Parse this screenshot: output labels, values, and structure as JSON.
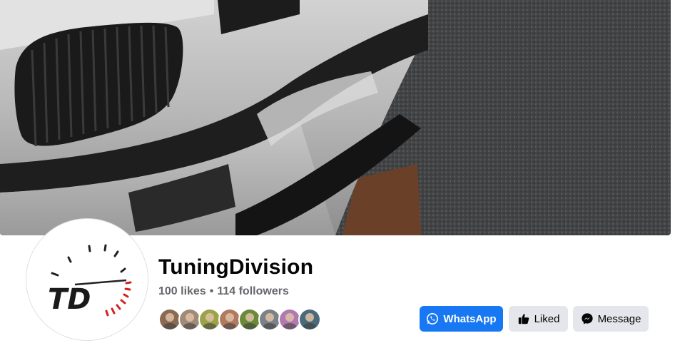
{
  "page": {
    "name": "TuningDivision",
    "likes": "100 likes",
    "separator": "•",
    "followers": "114 followers"
  },
  "profile_logo": {
    "text": "TD"
  },
  "friends": [
    {
      "name": "friend-avatar-1",
      "color": "#8a6a52"
    },
    {
      "name": "friend-avatar-2",
      "color": "#a08a78"
    },
    {
      "name": "friend-avatar-3",
      "color": "#9aa24a"
    },
    {
      "name": "friend-avatar-4",
      "color": "#b07a60"
    },
    {
      "name": "friend-avatar-5",
      "color": "#6a8a3a"
    },
    {
      "name": "friend-avatar-6",
      "color": "#7a8288"
    },
    {
      "name": "friend-avatar-7",
      "color": "#b07ab0"
    },
    {
      "name": "friend-avatar-8",
      "color": "#4a6a7a"
    }
  ],
  "buttons": {
    "whatsapp": "WhatsApp",
    "liked": "Liked",
    "message": "Message"
  },
  "colors": {
    "primary": "#1877f2",
    "secondary_button": "#e4e6eb",
    "muted_text": "#65676b"
  }
}
